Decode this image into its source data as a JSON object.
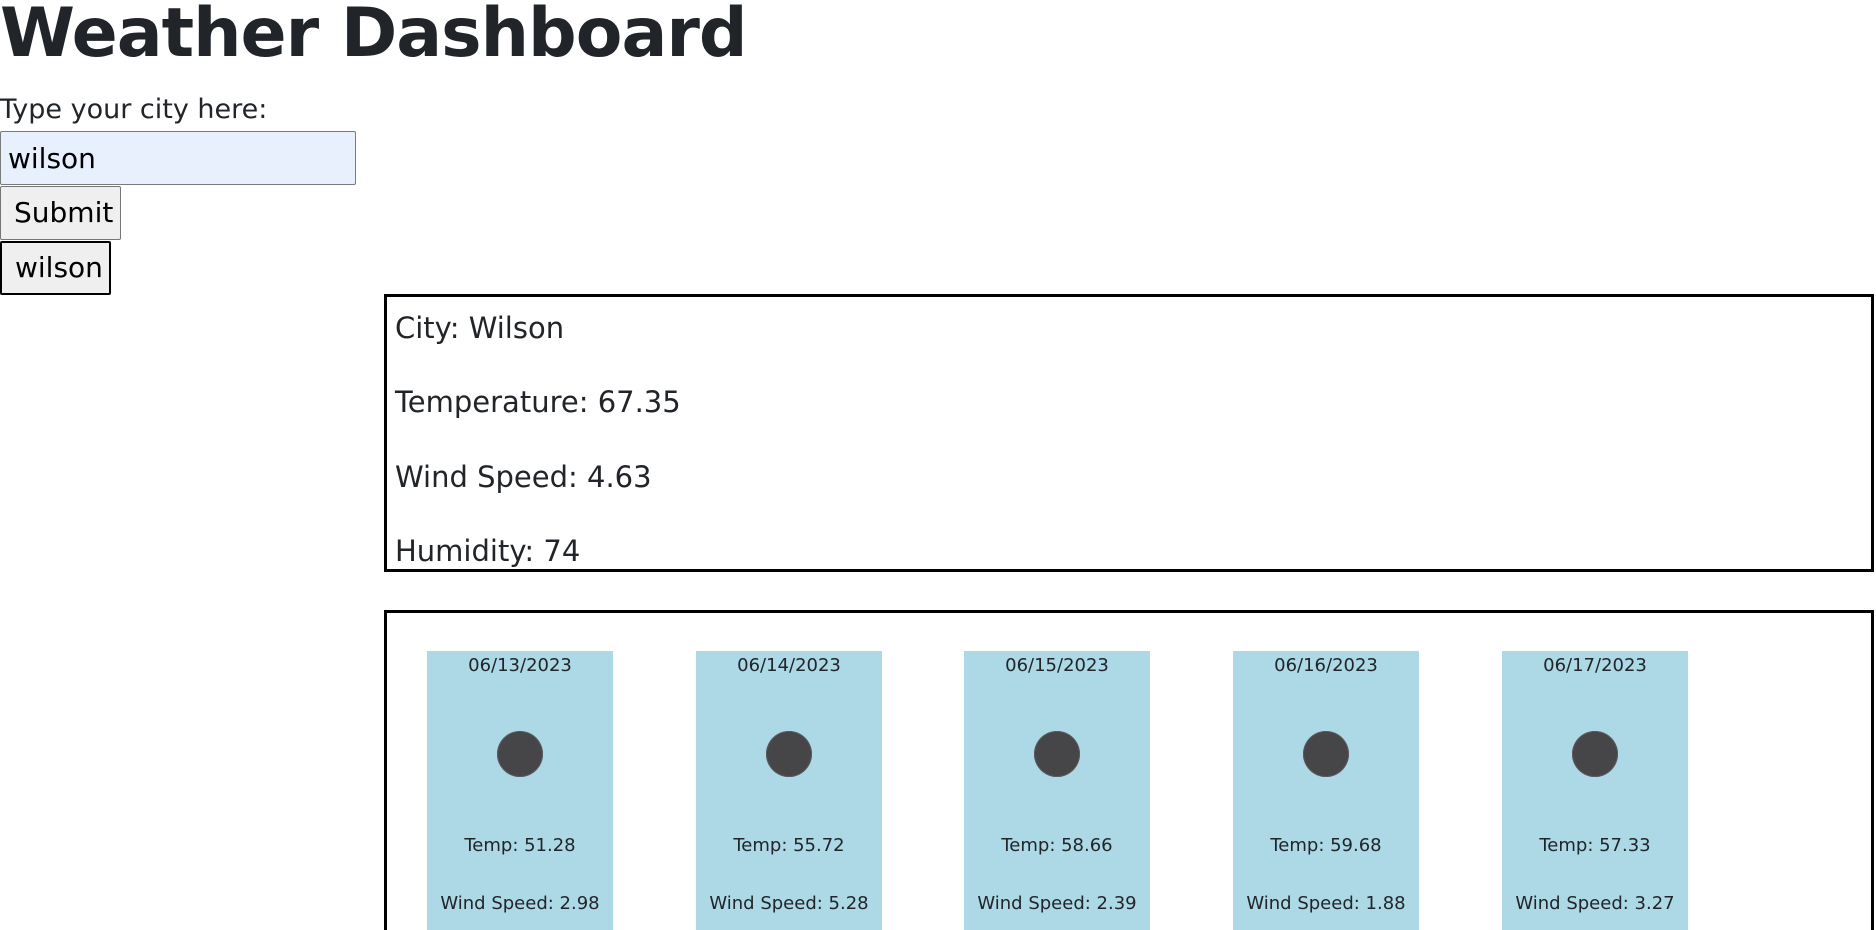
{
  "header": {
    "title": "Weather Dashboard"
  },
  "search": {
    "label": "Type your city here:",
    "value": "wilson",
    "submit_label": "Submit"
  },
  "history": {
    "items": [
      "wilson"
    ]
  },
  "current": {
    "city": "City: Wilson",
    "temperature": "Temperature: 67.35",
    "wind": "Wind Speed: 4.63",
    "humidity": "Humidity: 74"
  },
  "forecast": [
    {
      "date": "06/13/2023",
      "icon": "weather-icon",
      "temp": "Temp: 51.28",
      "wind": "Wind Speed: 2.98"
    },
    {
      "date": "06/14/2023",
      "icon": "weather-icon",
      "temp": "Temp: 55.72",
      "wind": "Wind Speed: 5.28"
    },
    {
      "date": "06/15/2023",
      "icon": "weather-icon",
      "temp": "Temp: 58.66",
      "wind": "Wind Speed: 2.39"
    },
    {
      "date": "06/16/2023",
      "icon": "weather-icon",
      "temp": "Temp: 59.68",
      "wind": "Wind Speed: 1.88"
    },
    {
      "date": "06/17/2023",
      "icon": "weather-icon",
      "temp": "Temp: 57.33",
      "wind": "Wind Speed: 3.27"
    }
  ],
  "colors": {
    "card_background": "#add8e6",
    "icon_color": "#464548",
    "input_background": "#e8f0fe"
  }
}
